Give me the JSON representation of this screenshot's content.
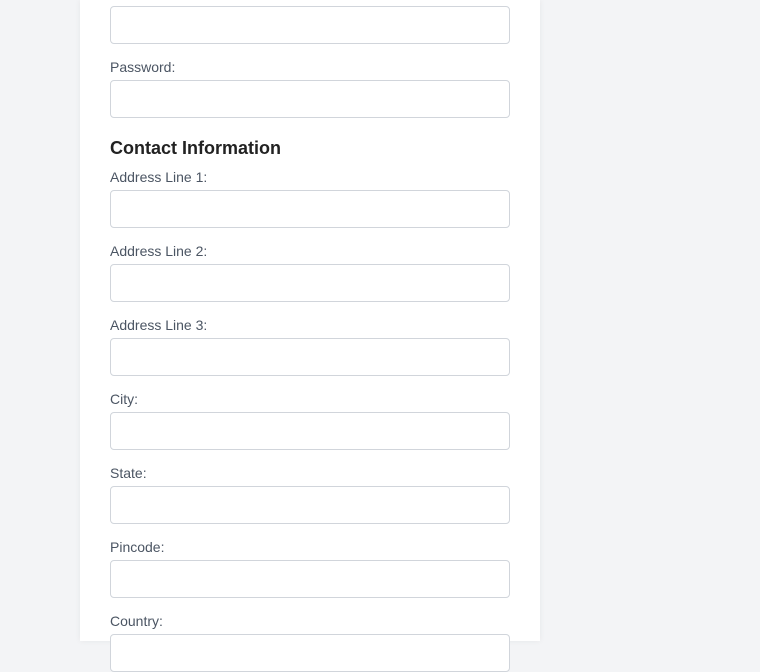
{
  "form": {
    "password_label": "Password:",
    "contact_section_title": "Contact Information",
    "address1_label": "Address Line 1:",
    "address2_label": "Address Line 2:",
    "address3_label": "Address Line 3:",
    "city_label": "City:",
    "state_label": "State:",
    "pincode_label": "Pincode:",
    "country_label": "Country:"
  }
}
